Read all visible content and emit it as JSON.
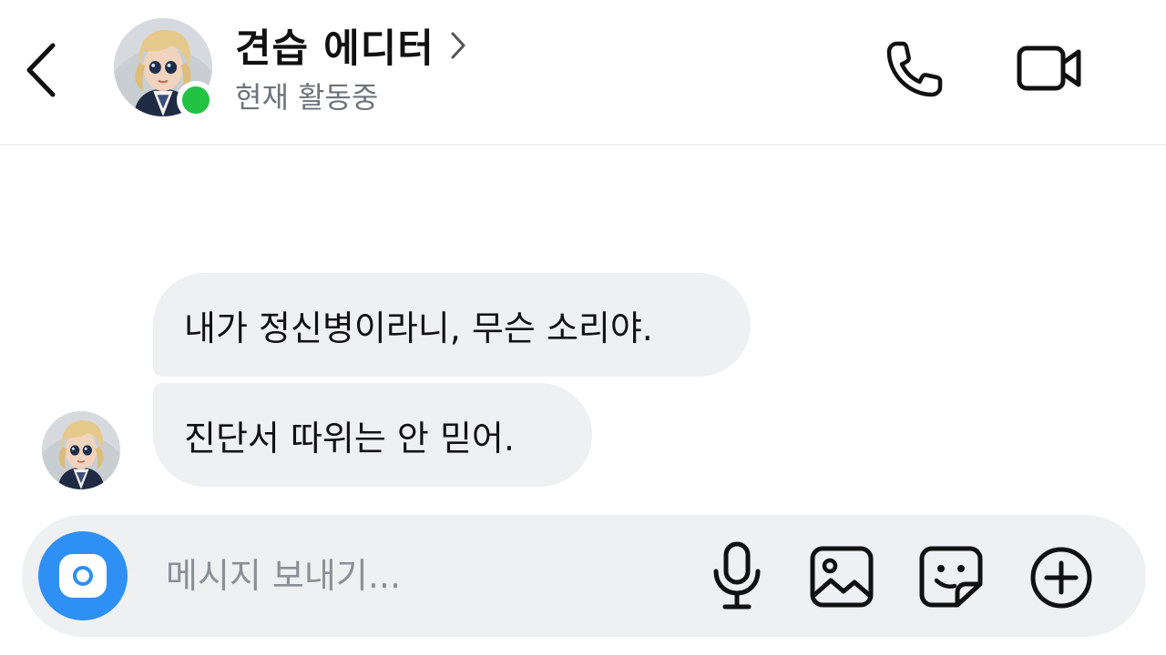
{
  "header": {
    "contact_name": "견습 에디터",
    "status": "현재 활동중",
    "online": true,
    "online_color": "#22c244"
  },
  "messages": [
    {
      "sender": "contact",
      "text": "내가 정신병이라니, 무슨 소리야."
    },
    {
      "sender": "contact",
      "text": "진단서 따위는 안 믿어."
    }
  ],
  "composer": {
    "placeholder": "메시지 보내기...",
    "value": "",
    "accent_color": "#2e8ff5"
  },
  "icons": {
    "back": "chevron-left-icon",
    "title_chevron": "chevron-right-icon",
    "call": "phone-icon",
    "video": "video-camera-icon",
    "camera": "camera-icon",
    "mic": "microphone-icon",
    "gallery": "image-icon",
    "sticker": "sticker-icon",
    "more": "plus-circle-icon"
  }
}
